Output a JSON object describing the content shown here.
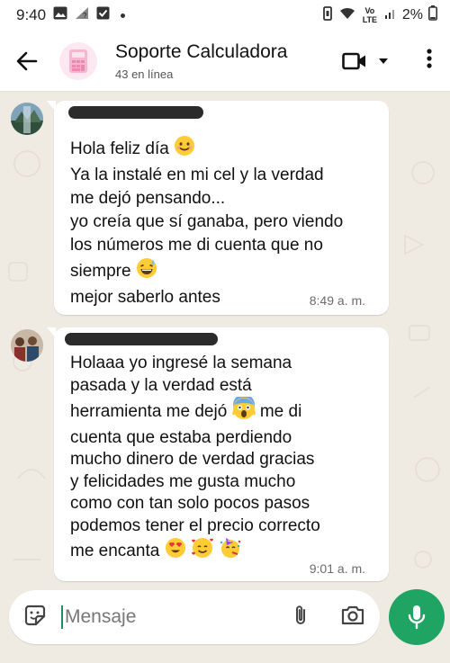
{
  "status_bar": {
    "time": "9:40",
    "battery": "2%",
    "network": "Vo LTE"
  },
  "header": {
    "title": "Soporte Calculadora",
    "subtitle": "43 en línea"
  },
  "messages": [
    {
      "lines": [
        "Hola feliz día",
        "Ya la instalé en mi cel y la verdad",
        "me dejó pensando...",
        "yo creía que sí ganaba, pero viendo",
        "los números me di cuenta que no",
        "siempre",
        "mejor saberlo antes"
      ],
      "time": "8:49 a. m."
    },
    {
      "lines": [
        "Holaaa yo ingresé la semana",
        "pasada y la verdad está",
        "herramienta me dejó",
        "me di",
        "cuenta que estaba perdiendo",
        "mucho dinero de verdad gracias",
        "y felicidades me gusta mucho",
        "como con tan solo pocos pasos",
        "podemos tener el precio correcto",
        "me encanta"
      ],
      "time": "9:01 a. m."
    }
  ],
  "composer": {
    "placeholder": "Mensaje"
  },
  "colors": {
    "accent": "#20a464",
    "chat_bg": "#efeae2",
    "bubble": "#ffffff"
  }
}
